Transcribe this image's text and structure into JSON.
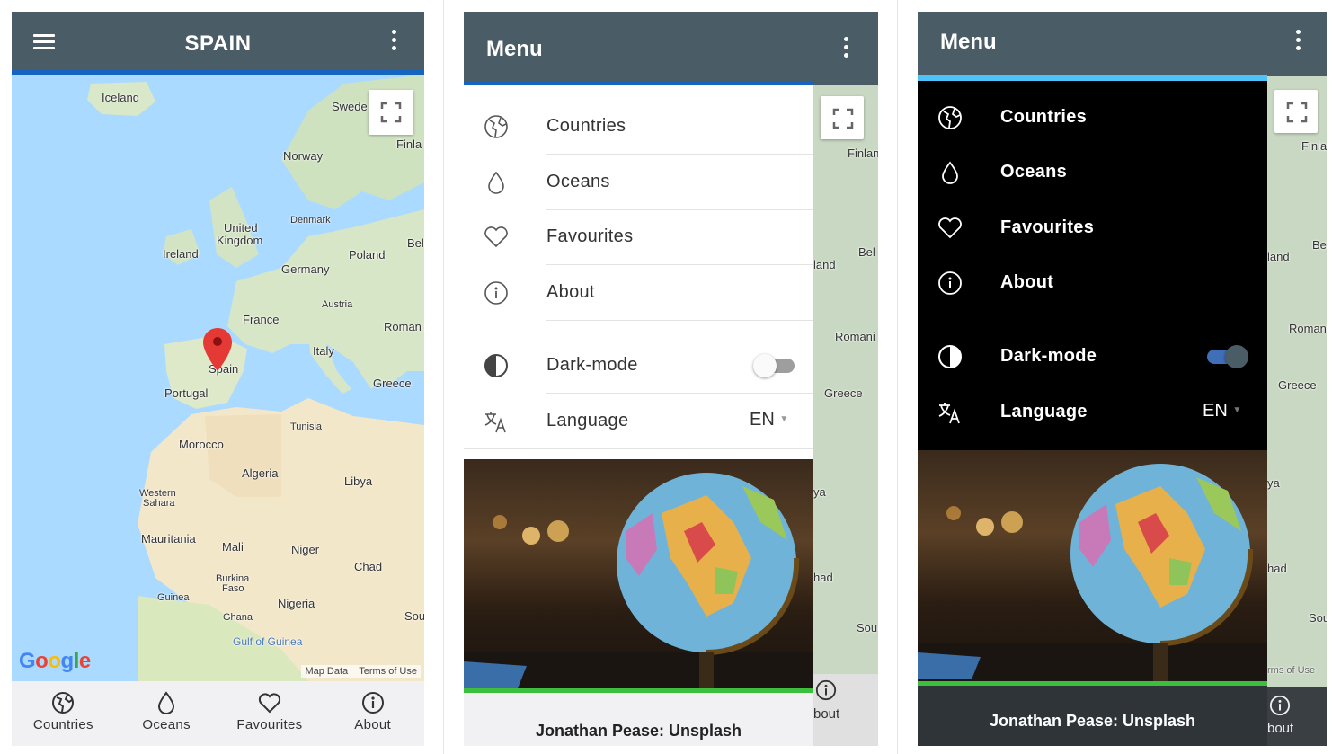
{
  "screen1": {
    "title": "SPAIN",
    "map_labels": {
      "iceland": "Iceland",
      "sweden": "Swede",
      "finland": "Finla",
      "norway": "Norway",
      "united_kingdom_1": "United",
      "united_kingdom_2": "Kingdom",
      "denmark": "Denmark",
      "ireland": "Ireland",
      "poland": "Poland",
      "belarus": "Bel",
      "germany": "Germany",
      "austria": "Austria",
      "france": "France",
      "romania": "Roman",
      "italy": "Italy",
      "spain": "Spain",
      "portugal": "Portugal",
      "greece": "Greece",
      "tunisia": "Tunisia",
      "morocco": "Morocco",
      "algeria": "Algeria",
      "libya": "Libya",
      "western_sahara_1": "Western",
      "western_sahara_2": "Sahara",
      "mauritania": "Mauritania",
      "mali": "Mali",
      "niger": "Niger",
      "chad": "Chad",
      "burkina_1": "Burkina",
      "burkina_2": "Faso",
      "guinea": "Guinea",
      "nigeria": "Nigeria",
      "ghana": "Ghana",
      "gulf": "Gulf of Guinea",
      "sou": "Sou"
    },
    "google": "Google",
    "map_data": "Map Data",
    "terms": "Terms of Use",
    "nav": [
      {
        "label": "Countries"
      },
      {
        "label": "Oceans"
      },
      {
        "label": "Favourites"
      },
      {
        "label": "About"
      }
    ]
  },
  "drawer": {
    "title": "Menu",
    "items": [
      {
        "label": "Countries"
      },
      {
        "label": "Oceans"
      },
      {
        "label": "Favourites"
      },
      {
        "label": "About"
      }
    ],
    "dark_mode_label": "Dark-mode",
    "language_label": "Language",
    "language_value": "EN",
    "credit": "Jonathan Pease: Unsplash"
  },
  "behind_labels": {
    "finland": "Finlan",
    "land": "land",
    "bel": "Bel",
    "romania": "Romani",
    "greece": "Greece",
    "ya": "ya",
    "had": "had",
    "sou": "Sou",
    "terms": "rms of Use",
    "about": "bout"
  },
  "colors": {
    "appbar": "#4a5c66",
    "accent_light": "#1565c0",
    "accent_dark": "#4fc3f7",
    "photo_line": "#3cbf3c",
    "dark_bg": "#000000"
  }
}
